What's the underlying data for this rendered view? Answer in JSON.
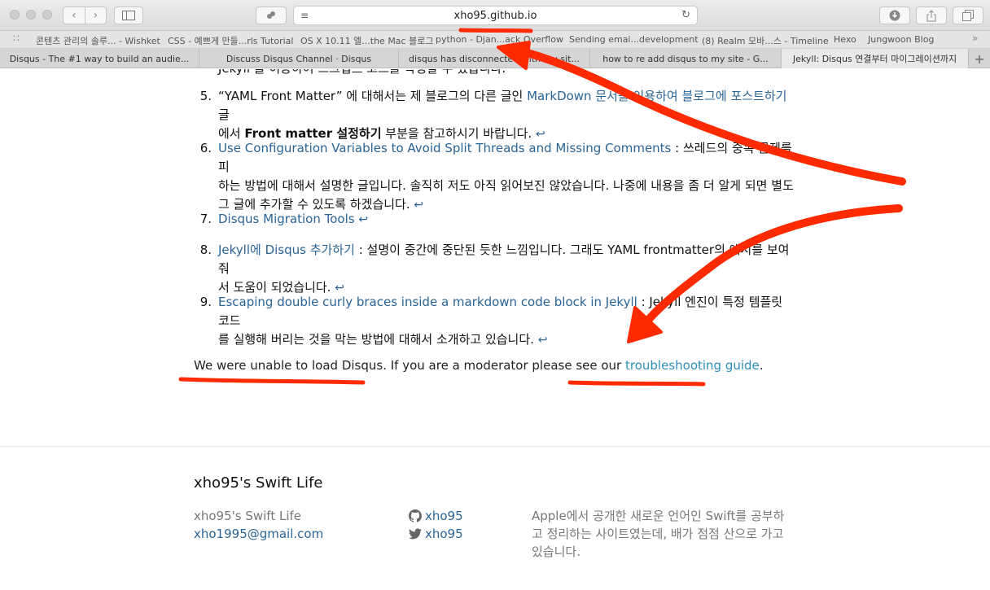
{
  "browser": {
    "url": "xho95.github.io",
    "bookmarks": [
      "콘텐츠 관리의 솔루... - Wishket",
      "CSS - 예쁘게 만들...rls Tutorial",
      "OS X 10.11 엘...the Mac 블로그",
      "python - Djan...ack Overflow",
      "Sending emai...development",
      "(8) Realm 모바...스 - Timeline",
      "Hexo",
      "Jungwoon Blog"
    ],
    "tabs": [
      "Disqus - The #1 way to build an audie...",
      "Discuss Disqus Channel · Disqus",
      "disqus has disconnected with my sit...",
      "how to re add disqus to my site - G...",
      "Jekyll: Disqus 연결부터 마이그레이션까지"
    ]
  },
  "page": {
    "cutoff_line": "Jekyll 을 이용하여 스크립트 코드를 작성할 수 있습니다.",
    "footnotes": [
      {
        "num": "5.",
        "line1_pre": "“YAML Front Matter” 에 대해서는 제 블로그의 다른 글인 ",
        "line1_link": "MarkDown 문서를 이용하여 블로그에 포스트하기",
        "line1_post": " 글",
        "line2_pre": "에서 ",
        "line2_bold": "Front matter 설정하기",
        "line2_post": " 부분을 참고하시기 바랍니다. "
      },
      {
        "num": "6.",
        "link": "Use Configuration Variables to Avoid Split Threads and Missing Comments",
        "line1_post": " : 쓰레드의 중복 문제를 피",
        "line2": "하는 방법에 대해서 설명한 글입니다. 솔직히 저도 아직 읽어보진 않았습니다. 나중에 내용을 좀 더 알게 되면 별도",
        "line3": "그 글에 추가할 수 있도록 하겠습니다. "
      },
      {
        "num": "7.",
        "link": "Disqus Migration Tools"
      },
      {
        "num": "8.",
        "link": "Jekyll에 Disqus 추가하기",
        "line1_post": " : 설명이 중간에 중단된 듯한 느낌입니다. 그래도 YAML frontmatter의 예시를 보여줘",
        "line2": "서 도움이 되었습니다. "
      },
      {
        "num": "9.",
        "link": "Escaping double curly braces inside a markdown code block in Jekyll",
        "line1_post": " : Jekyll 엔진이 특정 템플릿 코드",
        "line2": "를 실행해 버리는 것을 막는 방법에 대해서 소개하고 있습니다. "
      }
    ],
    "back_glyph": "↩",
    "disqus_msg_pre": "We were unable to load Disqus. If you are a moderator please see our ",
    "disqus_msg_link": "troubleshooting guide",
    "disqus_msg_post": "."
  },
  "footer": {
    "title": "xho95's Swift Life",
    "site_name": "xho95's Swift Life",
    "email": "xho1995@gmail.com",
    "github": "xho95",
    "twitter": "xho95",
    "description": "Apple에서 공개한 새로운 언어인 Swift를 공부하고 정리하는 사이트였는데, 배가 점점 산으로 가고 있습니다."
  },
  "icons": {
    "back": "chevron-left-icon",
    "forward": "chevron-right-icon",
    "sidebar": "sidebar-icon",
    "reader": "reader-icon",
    "reload": "reload-icon",
    "download": "download-icon",
    "share": "share-icon",
    "tabs": "tabs-icon",
    "github": "github-icon",
    "twitter": "twitter-icon"
  },
  "colors": {
    "link": "#2a6496",
    "disqus_link": "#2d8fb8",
    "annotation": "#ff2a00"
  }
}
